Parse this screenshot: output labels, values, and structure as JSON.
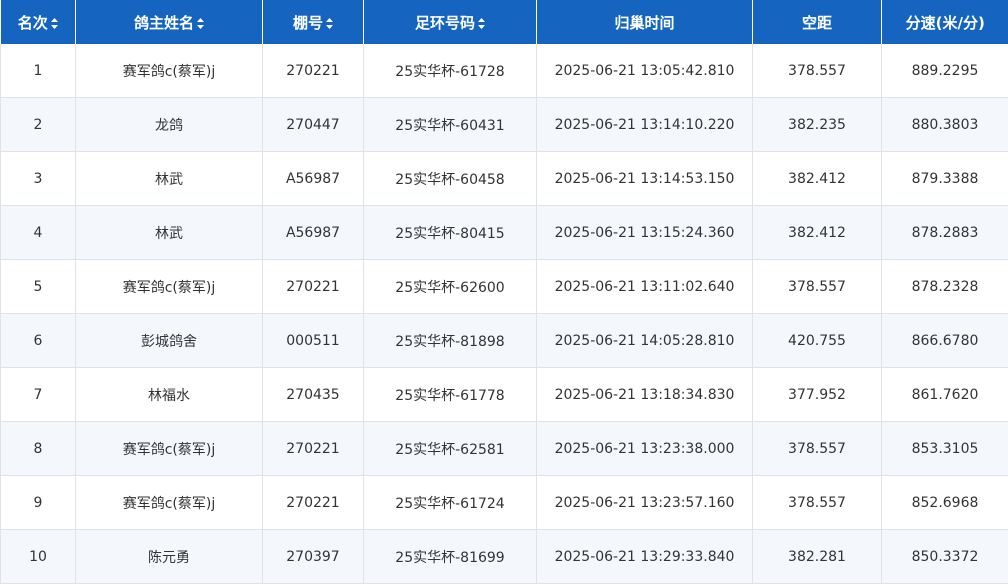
{
  "columns": [
    {
      "label": "名次",
      "sortable": true
    },
    {
      "label": "鸽主姓名",
      "sortable": true
    },
    {
      "label": "棚号",
      "sortable": true
    },
    {
      "label": "足环号码",
      "sortable": true
    },
    {
      "label": "归巢时间",
      "sortable": false
    },
    {
      "label": "空距",
      "sortable": false
    },
    {
      "label": "分速(米/分)",
      "sortable": false
    }
  ],
  "rows": [
    [
      "1",
      "赛军鸽c(蔡军)j",
      "270221",
      "25实华杯-61728",
      "2025-06-21 13:05:42.810",
      "378.557",
      "889.2295"
    ],
    [
      "2",
      "龙鸽",
      "270447",
      "25实华杯-60431",
      "2025-06-21 13:14:10.220",
      "382.235",
      "880.3803"
    ],
    [
      "3",
      "林武",
      "A56987",
      "25实华杯-60458",
      "2025-06-21 13:14:53.150",
      "382.412",
      "879.3388"
    ],
    [
      "4",
      "林武",
      "A56987",
      "25实华杯-80415",
      "2025-06-21 13:15:24.360",
      "382.412",
      "878.2883"
    ],
    [
      "5",
      "赛军鸽c(蔡军)j",
      "270221",
      "25实华杯-62600",
      "2025-06-21 13:11:02.640",
      "378.557",
      "878.2328"
    ],
    [
      "6",
      "彭城鸽舍",
      "000511",
      "25实华杯-81898",
      "2025-06-21 14:05:28.810",
      "420.755",
      "866.6780"
    ],
    [
      "7",
      "林福水",
      "270435",
      "25实华杯-61778",
      "2025-06-21 13:18:34.830",
      "377.952",
      "861.7620"
    ],
    [
      "8",
      "赛军鸽c(蔡军)j",
      "270221",
      "25实华杯-62581",
      "2025-06-21 13:23:38.000",
      "378.557",
      "853.3105"
    ],
    [
      "9",
      "赛军鸽c(蔡军)j",
      "270221",
      "25实华杯-61724",
      "2025-06-21 13:23:57.160",
      "378.557",
      "852.6968"
    ],
    [
      "10",
      "陈元勇",
      "270397",
      "25实华杯-81699",
      "2025-06-21 13:29:33.840",
      "382.281",
      "850.3372"
    ]
  ],
  "colors": {
    "header_bg": "#1565c0",
    "header_text": "#ffffff",
    "row_alt_bg": "#f4f8fd",
    "grid_line": "#dfe3e8",
    "cell_text": "#333333"
  },
  "icons": {
    "sort": "sort-icon"
  }
}
